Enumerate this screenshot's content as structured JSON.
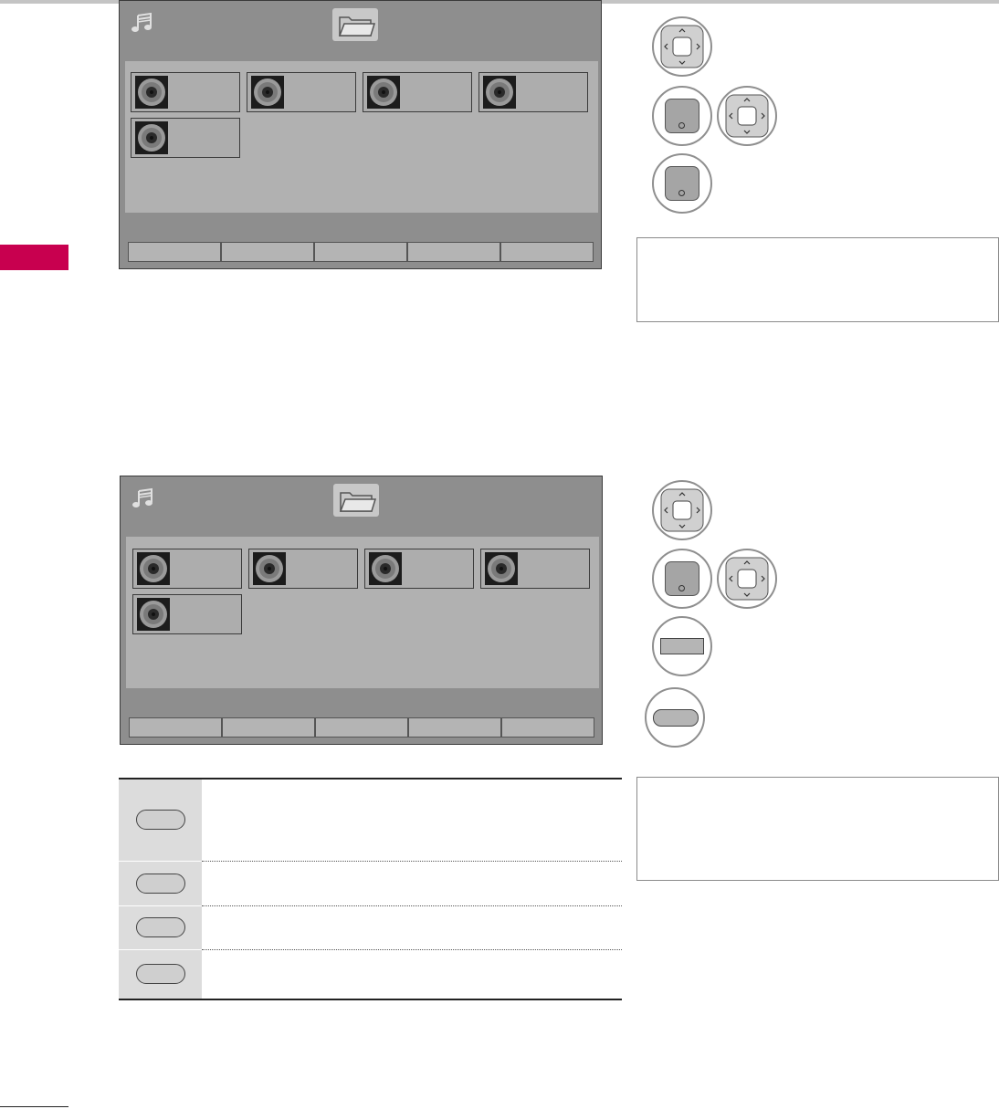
{
  "page": {
    "accent_color": "#c8004f",
    "background": "#ffffff"
  },
  "screens": [
    {
      "header_icon": "music-note-icon",
      "folder_icon": "folder-icon",
      "tiles": [
        {
          "icon": "disc-icon",
          "label": ""
        },
        {
          "icon": "disc-icon",
          "label": ""
        },
        {
          "icon": "disc-icon",
          "label": ""
        },
        {
          "icon": "disc-icon",
          "label": ""
        },
        {
          "icon": "disc-icon",
          "label": ""
        }
      ],
      "bottom_bar": [
        "",
        "",
        "",
        "",
        ""
      ]
    },
    {
      "header_icon": "music-note-icon",
      "folder_icon": "folder-icon",
      "tiles": [
        {
          "icon": "disc-icon",
          "label": ""
        },
        {
          "icon": "disc-icon",
          "label": ""
        },
        {
          "icon": "disc-icon",
          "label": ""
        },
        {
          "icon": "disc-icon",
          "label": ""
        },
        {
          "icon": "disc-icon",
          "label": ""
        }
      ],
      "bottom_bar": [
        "",
        "",
        "",
        "",
        ""
      ]
    }
  ],
  "remote_steps_top": [
    "navigation-pad-icon",
    "ok-button-icon",
    "navigation-pad-icon",
    "ok-button-icon"
  ],
  "remote_steps_bottom": [
    "navigation-pad-icon",
    "ok-button-icon",
    "navigation-pad-icon",
    "rectangular-button-icon",
    "pill-button-icon"
  ],
  "notes": {
    "top": "",
    "bottom": ""
  },
  "function_table": {
    "rows": [
      {
        "key_icon": "pill-button-icon",
        "description": ""
      },
      {
        "key_icon": "pill-button-icon",
        "description": ""
      },
      {
        "key_icon": "pill-button-icon",
        "description": ""
      },
      {
        "key_icon": "pill-button-icon",
        "description": ""
      }
    ]
  }
}
